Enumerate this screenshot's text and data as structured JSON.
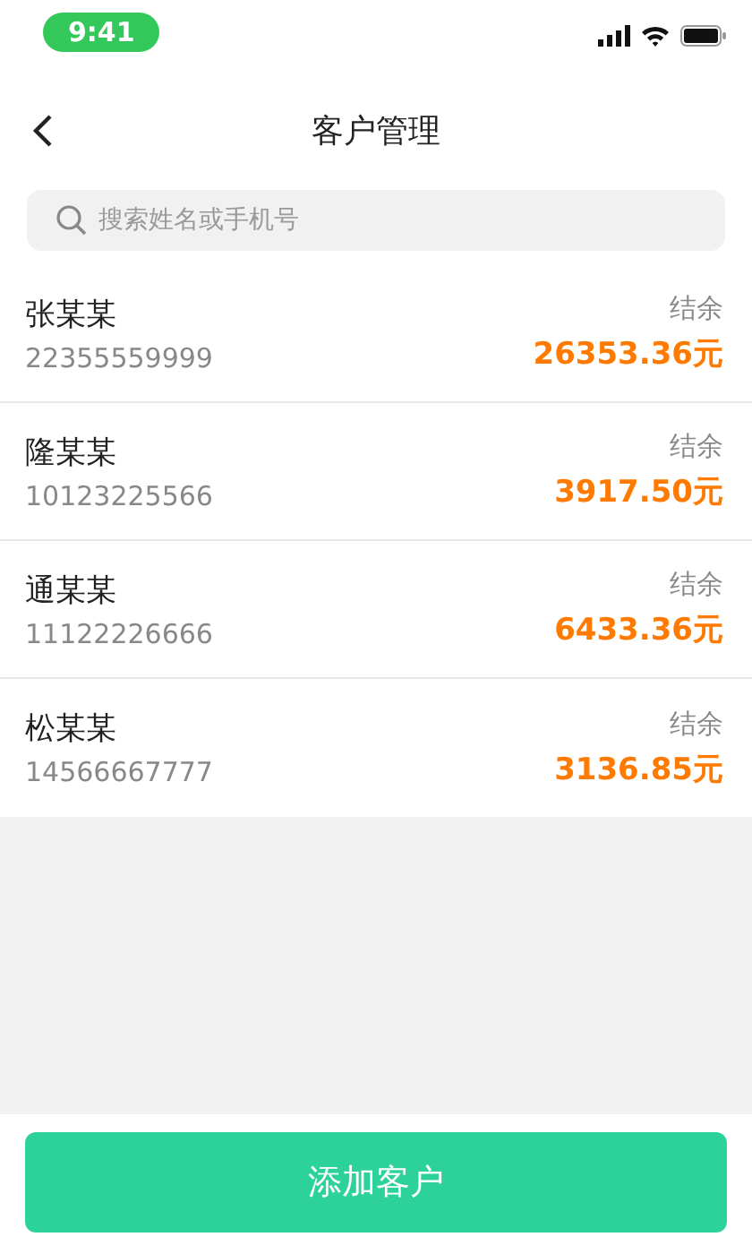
{
  "status_bar": {
    "time": "9:41"
  },
  "nav": {
    "title": "客户管理"
  },
  "search": {
    "placeholder": "搜索姓名或手机号"
  },
  "customers": [
    {
      "name": "张某某",
      "phone": "22355559999",
      "balance_label": "结余",
      "balance": "26353.36元"
    },
    {
      "name": "隆某某",
      "phone": "10123225566",
      "balance_label": "结余",
      "balance": "3917.50元"
    },
    {
      "name": "通某某",
      "phone": "11122226666",
      "balance_label": "结余",
      "balance": "6433.36元"
    },
    {
      "name": "松某某",
      "phone": "14566667777",
      "balance_label": "结余",
      "balance": "3136.85元"
    }
  ],
  "footer": {
    "button": "添加客户"
  }
}
